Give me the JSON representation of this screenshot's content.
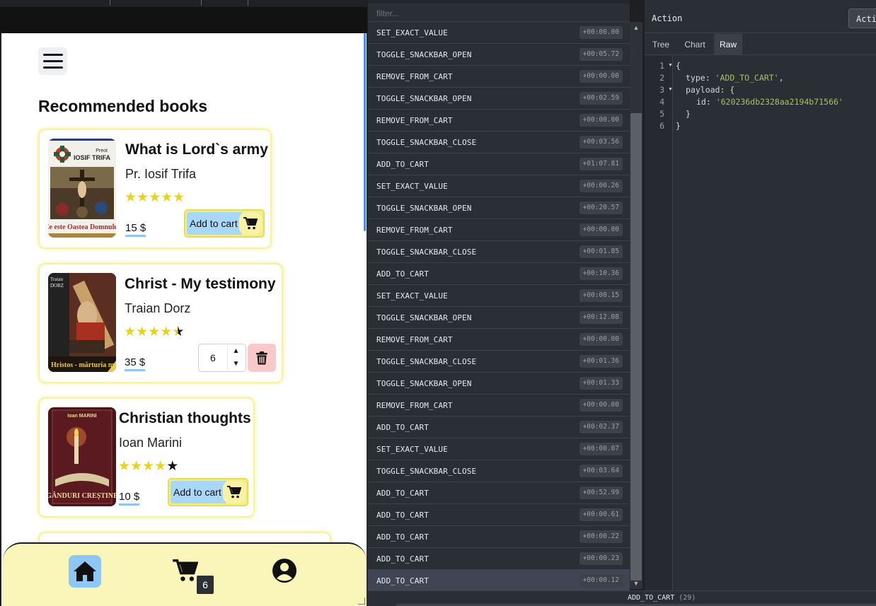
{
  "app": {
    "section_title": "Recommended books",
    "books": [
      {
        "title": "What is Lord`s army",
        "author": "Pr. Iosif Trifa",
        "rating": 5,
        "price": "15 $",
        "cta": "Add to cart",
        "cover_top": "Preot IOSIF TRIFA",
        "cover_bottom": "Ce este Oastea Domnului"
      },
      {
        "title": "Christ - My testimony",
        "author": "Traian Dorz",
        "rating": 4.5,
        "price": "35 $",
        "quantity": "6",
        "cover_top": "Traian DORZ",
        "cover_bottom": "Hristos - mărturia m"
      },
      {
        "title": "Christian thoughts",
        "author": "Ioan Marini",
        "rating": 4,
        "price": "10 $",
        "cta": "Add to cart",
        "cover_top": "Ioan MARINI",
        "cover_bottom": "GÂNDURI CREȘTINE"
      }
    ],
    "nav": {
      "home": "home-icon",
      "cart": "cart-icon",
      "cart_count": "6",
      "profile": "user-circle-icon"
    },
    "colors": {
      "accent_yellow": "#f3ee8a",
      "accent_blue": "#a9d7f7",
      "nav_bg": "#faf5b9",
      "delete_bg": "#f9c9c9",
      "star": "#e6d31c"
    }
  },
  "devtools": {
    "filter_placeholder": "filter...",
    "actions": [
      {
        "name": "SET_EXACT_VALUE",
        "time": "+00:00.00"
      },
      {
        "name": "TOGGLE_SNACKBAR_OPEN",
        "time": "+00:05.72"
      },
      {
        "name": "REMOVE_FROM_CART",
        "time": "+00:00.00"
      },
      {
        "name": "TOGGLE_SNACKBAR_OPEN",
        "time": "+00:02.59"
      },
      {
        "name": "REMOVE_FROM_CART",
        "time": "+00:00.00"
      },
      {
        "name": "TOGGLE_SNACKBAR_CLOSE",
        "time": "+00:03.56"
      },
      {
        "name": "ADD_TO_CART",
        "time": "+01:07.81"
      },
      {
        "name": "SET_EXACT_VALUE",
        "time": "+00:00.26"
      },
      {
        "name": "TOGGLE_SNACKBAR_OPEN",
        "time": "+00:20.57"
      },
      {
        "name": "REMOVE_FROM_CART",
        "time": "+00:00.00"
      },
      {
        "name": "TOGGLE_SNACKBAR_CLOSE",
        "time": "+00:01.85"
      },
      {
        "name": "ADD_TO_CART",
        "time": "+00:10.36"
      },
      {
        "name": "SET_EXACT_VALUE",
        "time": "+00:00.15"
      },
      {
        "name": "TOGGLE_SNACKBAR_OPEN",
        "time": "+00:12.08"
      },
      {
        "name": "REMOVE_FROM_CART",
        "time": "+00:00.00"
      },
      {
        "name": "TOGGLE_SNACKBAR_CLOSE",
        "time": "+00:01.36"
      },
      {
        "name": "TOGGLE_SNACKBAR_OPEN",
        "time": "+00:01.33"
      },
      {
        "name": "REMOVE_FROM_CART",
        "time": "+00:00.00"
      },
      {
        "name": "ADD_TO_CART",
        "time": "+00:02.37"
      },
      {
        "name": "SET_EXACT_VALUE",
        "time": "+00:00.07"
      },
      {
        "name": "TOGGLE_SNACKBAR_CLOSE",
        "time": "+00:03.64"
      },
      {
        "name": "ADD_TO_CART",
        "time": "+00:52.99"
      },
      {
        "name": "ADD_TO_CART",
        "time": "+00:00.61"
      },
      {
        "name": "ADD_TO_CART",
        "time": "+00:00.22"
      },
      {
        "name": "ADD_TO_CART",
        "time": "+00:00.23"
      },
      {
        "name": "ADD_TO_CART",
        "time": "+00:00.12",
        "selected": true
      }
    ],
    "panel_title": "Action",
    "panel_button": "Acti",
    "tabs": [
      "Tree",
      "Chart",
      "Raw"
    ],
    "active_tab": "Raw",
    "code": {
      "line_numbers": [
        "1",
        "2",
        "3",
        "4",
        "5",
        "6"
      ],
      "open_brace": "{",
      "type_key": "type: ",
      "type_value": "'ADD_TO_CART'",
      "type_comma": ",",
      "payload_key": "payload: {",
      "id_key": "id: ",
      "id_value": "'620236db2328aa2194b71566'",
      "close_inner": "}",
      "close_outer": "}"
    },
    "footer_action": "ADD_TO_CART",
    "footer_count": "(29)"
  }
}
